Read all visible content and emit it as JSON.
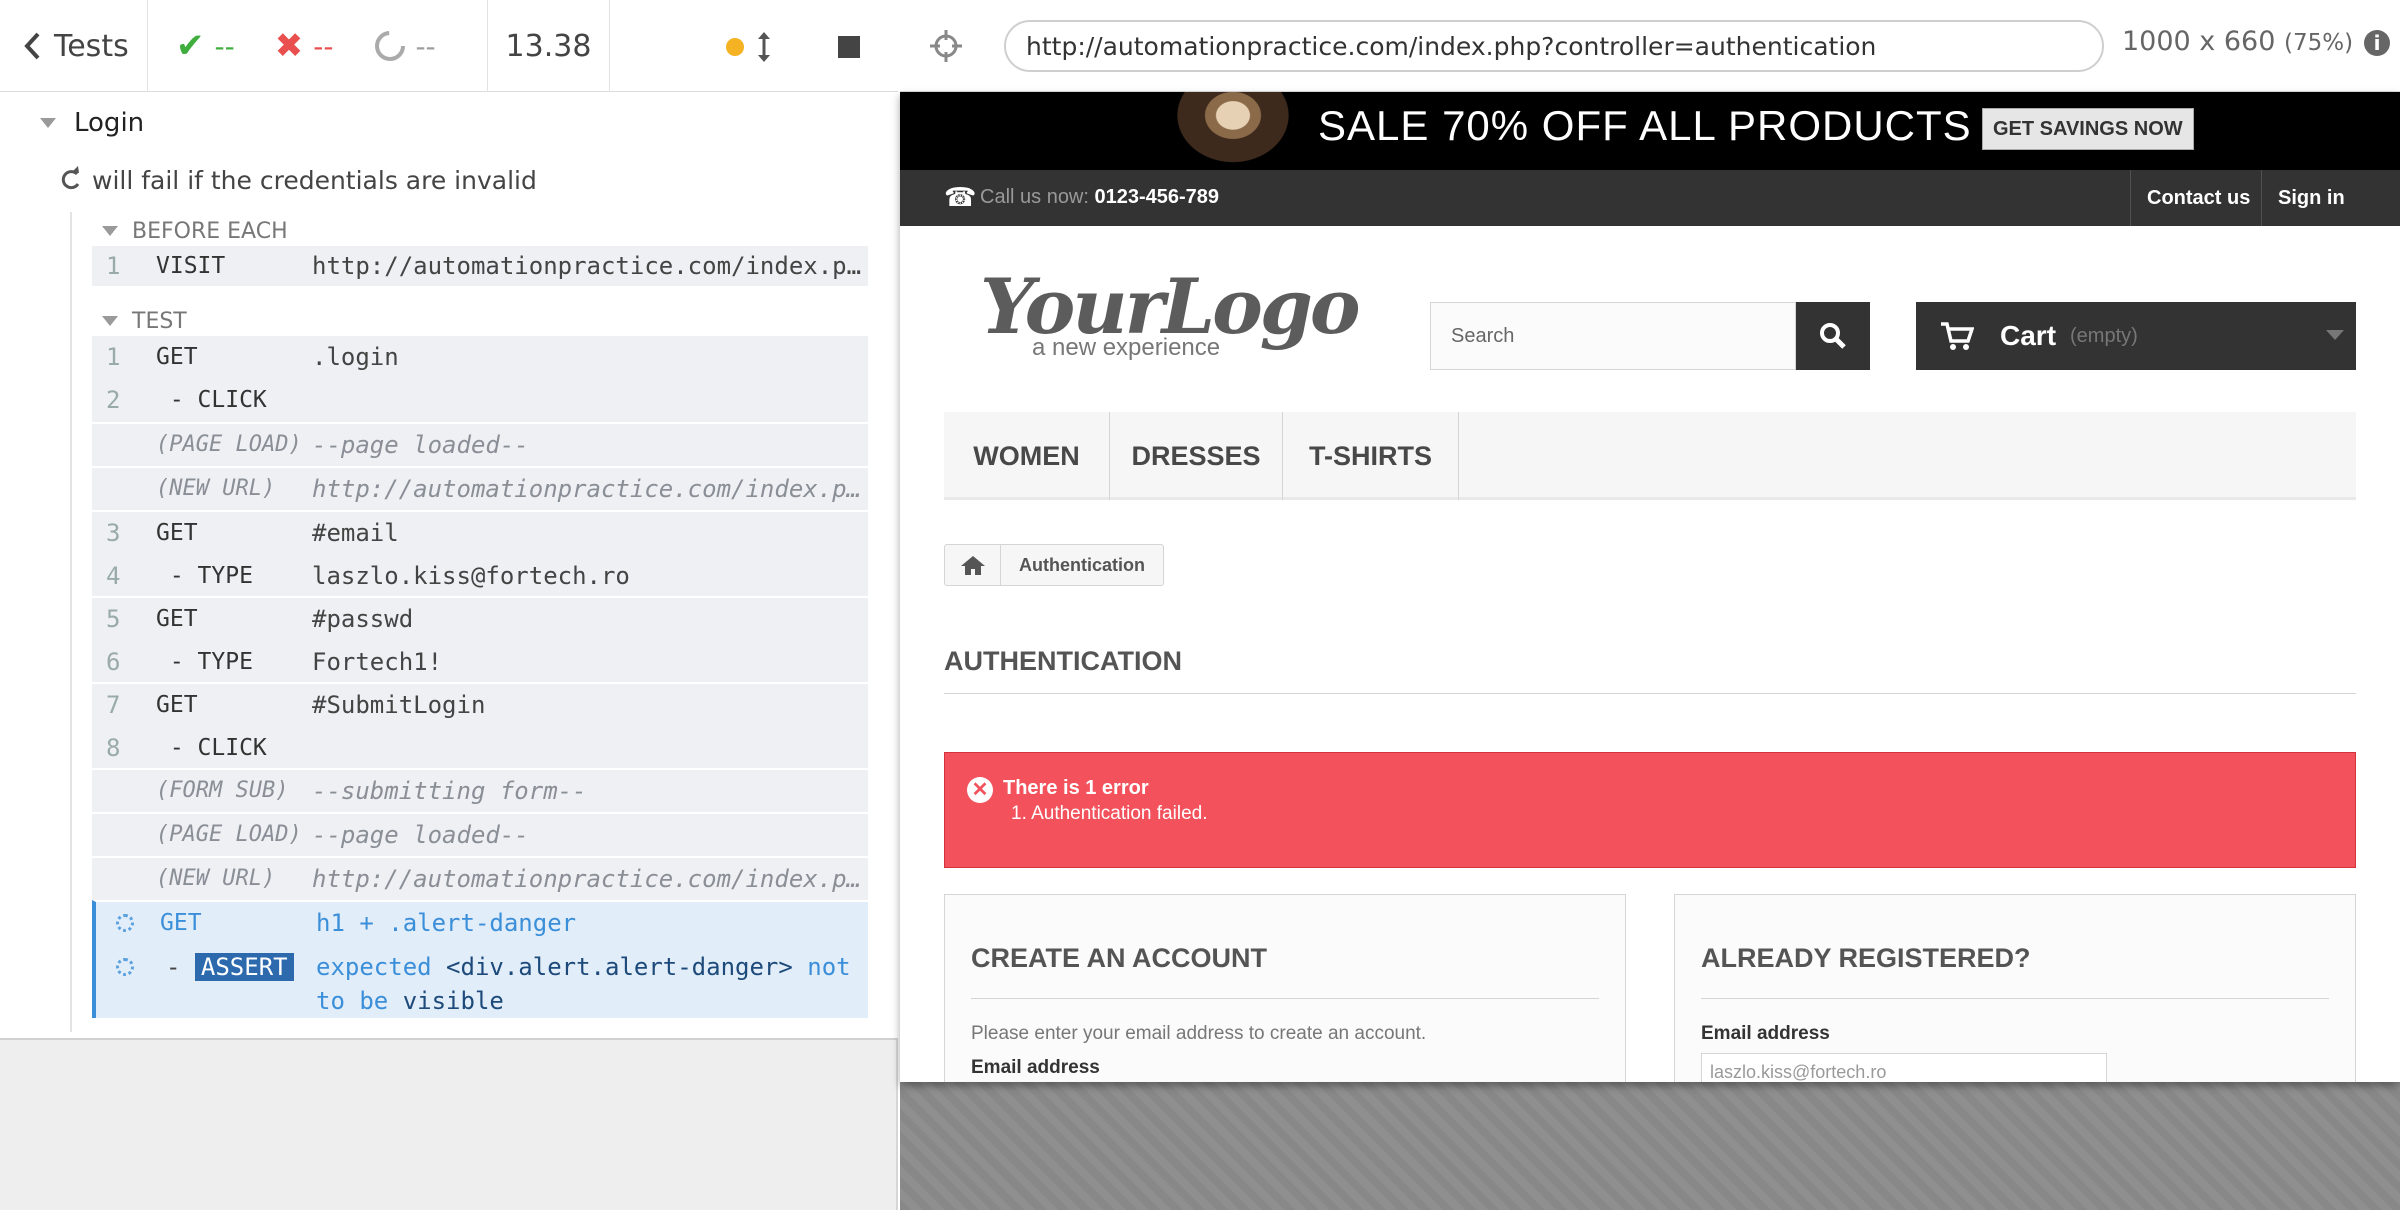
{
  "runner": {
    "back_label": "Tests",
    "passed": "--",
    "failed": "--",
    "pending": "--",
    "duration": "13.38"
  },
  "suite": {
    "title": "Login",
    "test_title": "will fail if the credentials are invalid",
    "hook_label": "BEFORE EACH",
    "test_label": "TEST",
    "hook_commands": [
      {
        "num": "1",
        "name": "VISIT",
        "message": "http://automationpractice.com/index.php?controller=authentication"
      }
    ],
    "test_commands": [
      {
        "num": "1",
        "name": "GET",
        "message": ".login"
      },
      {
        "num": "2",
        "name": " - CLICK",
        "message": ""
      },
      {
        "num": "",
        "name": "(PAGE LOAD)",
        "message": "--page loaded--"
      },
      {
        "num": "",
        "name": "(NEW URL)",
        "message": "http://automationpractice.com/index.php?controller=authentication"
      },
      {
        "num": "3",
        "name": "GET",
        "message": "#email"
      },
      {
        "num": "4",
        "name": " - TYPE",
        "message": "laszlo.kiss@fortech.ro"
      },
      {
        "num": "5",
        "name": "GET",
        "message": "#passwd"
      },
      {
        "num": "6",
        "name": " - TYPE",
        "message": "Fortech1!"
      },
      {
        "num": "7",
        "name": "GET",
        "message": "#SubmitLogin"
      },
      {
        "num": "8",
        "name": " - CLICK",
        "message": ""
      },
      {
        "num": "",
        "name": "(FORM SUB)",
        "message": "--submitting form--"
      },
      {
        "num": "",
        "name": "(PAGE LOAD)",
        "message": "--page loaded--"
      },
      {
        "num": "",
        "name": "(NEW URL)",
        "message": "http://automationpractice.com/index.php?controller=authentication"
      },
      {
        "num": "",
        "name": "GET",
        "message": "h1 + .alert-danger"
      }
    ],
    "assert": {
      "prefix": "-",
      "badge": "ASSERT",
      "expected": "expected",
      "subject": "<div.alert.alert-danger>",
      "not": "not",
      "to_be": "to be",
      "visible": "visible"
    }
  },
  "aut": {
    "url": "http://automationpractice.com/index.php?controller=authentication",
    "viewport": "1000 x 660",
    "scale": "(75%)",
    "banner": {
      "title": "SALE 70% OFF ALL PRODUCTS",
      "button": "GET SAVINGS NOW"
    },
    "contact": {
      "call_label": "Call us now:",
      "phone": "0123-456-789",
      "contact_link": "Contact us",
      "signin_link": "Sign in"
    },
    "logo": {
      "main": "YourLogo",
      "sub": "a new experience"
    },
    "search_placeholder": "Search",
    "cart": {
      "label": "Cart",
      "status": "(empty)"
    },
    "menu": [
      "WOMEN",
      "DRESSES",
      "T-SHIRTS"
    ],
    "breadcrumb": "Authentication",
    "heading": "AUTHENTICATION",
    "alert": {
      "title": "There is 1 error",
      "message": "1. Authentication failed."
    },
    "create": {
      "title": "CREATE AN ACCOUNT",
      "text": "Please enter your email address to create an account.",
      "email_label": "Email address"
    },
    "registered": {
      "title": "ALREADY REGISTERED?",
      "email_label": "Email address",
      "email_value": "laszlo.kiss@fortech.ro"
    }
  },
  "colors": {
    "passed": "#3fae3f",
    "failed": "#e94f4f",
    "pending": "#9d9d9d",
    "alert": "#f3515c",
    "accent": "#3b8fd9"
  }
}
